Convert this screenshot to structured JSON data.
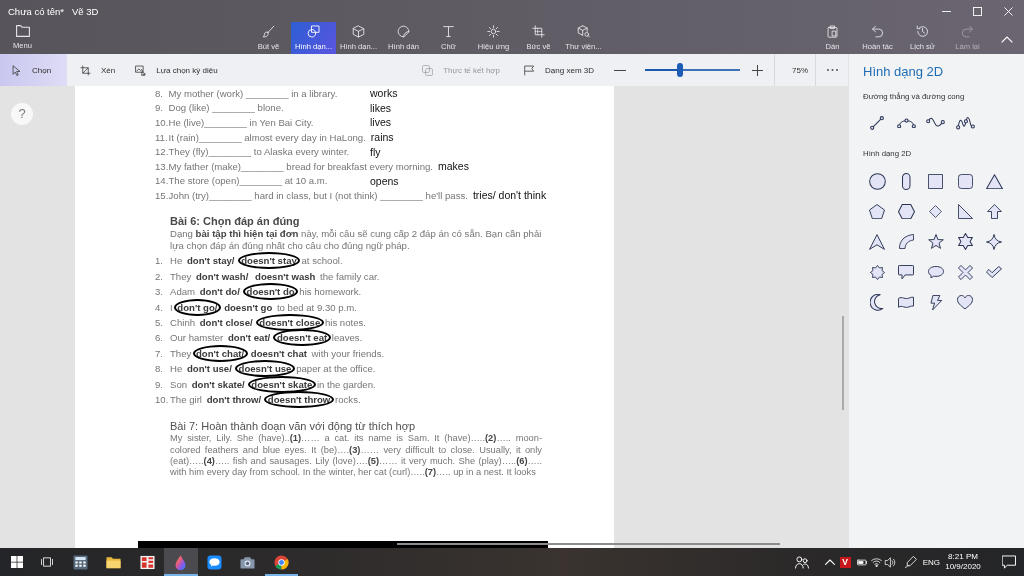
{
  "window": {
    "title": "Chưa có tên*",
    "app_name": "Vẽ 3D"
  },
  "ribbon": {
    "menu": {
      "label": "Menu"
    },
    "tools": [
      {
        "label": "Bút vẽ",
        "selected": false
      },
      {
        "label": "Hình dạn...",
        "selected": true
      },
      {
        "label": "Hình dạn...",
        "selected": false
      },
      {
        "label": "Hình dán",
        "selected": false
      },
      {
        "label": "Chữ",
        "selected": false
      },
      {
        "label": "Hiệu ứng",
        "selected": false
      },
      {
        "label": "Bức vẽ",
        "selected": false
      },
      {
        "label": "Thư viện...",
        "selected": false
      }
    ],
    "actions": [
      {
        "label": "Dán",
        "disabled": false
      },
      {
        "label": "Hoàn tác",
        "disabled": false
      },
      {
        "label": "Lịch sử",
        "disabled": false
      },
      {
        "label": "Làm lại",
        "disabled": true
      }
    ]
  },
  "toolbar": {
    "tools": [
      {
        "label": "Chọn",
        "selected": true
      },
      {
        "label": "Xén",
        "selected": false
      },
      {
        "label": "Lựa chọn kỳ diệu",
        "selected": false
      }
    ],
    "mixed_reality": {
      "label": "Thực tế kết hợp",
      "disabled": true
    },
    "view_3d": {
      "label": "Dạng xem 3D"
    },
    "zoom": {
      "level": 0.37,
      "reading": "75%"
    }
  },
  "canvas": {
    "help_button": {
      "label": "?"
    }
  },
  "document": {
    "exercise_5": {
      "items": [
        {
          "number": "8.",
          "text": "My mother (work) ________ in a library.",
          "answer": "works"
        },
        {
          "number": "9.",
          "text": "Dog (like) ________ blone.",
          "answer": "likes"
        },
        {
          "number": "10.",
          "text": "He (live)________ in Yen Bai City.",
          "answer": "lives"
        },
        {
          "number": "11.",
          "text": "It (rain)________ almost every day in HaLong.",
          "answer": "rains"
        },
        {
          "number": "12.",
          "text": "They (fly)________ to Alaska every winter.",
          "answer": "fly"
        },
        {
          "number": "13.",
          "text": "My father (make)________ bread for breakfast every morning.",
          "answer": "makes"
        },
        {
          "number": "14.",
          "text": "The store (open)________ at 10 a.m.",
          "answer": "opens"
        },
        {
          "number": "15.",
          "text": "John (try)________ hard in class, but I (not think) ________ he'll pass.",
          "answer": "tries/ don't think"
        }
      ]
    },
    "exercise_6": {
      "title": "Bài 6: Chọn đáp án đúng",
      "instructions": "Dạng **bài tập thì hiện tại đơn** này, mỗi câu sẽ cung cấp 2 đáp án có sẵn. Bạn cần phải lựa chọn đáp án đúng nhất cho câu cho đúng ngữ pháp.",
      "items": [
        {
          "number": "1.",
          "subject": "He",
          "choices": [
            {
              "text": "don't stay/",
              "circled": false
            },
            {
              "text": "doesn't stay",
              "circled": true
            }
          ],
          "rest": "at school."
        },
        {
          "number": "2.",
          "subject": "They",
          "choices": [
            {
              "text": "don't wash/",
              "circled": false
            },
            {
              "text": "doesn't wash",
              "circled": false
            }
          ],
          "rest": "the family car."
        },
        {
          "number": "3.",
          "subject": "Adam",
          "choices": [
            {
              "text": "don't do/",
              "circled": false
            },
            {
              "text": "doesn't do",
              "circled": true
            }
          ],
          "rest": "his homework."
        },
        {
          "number": "4.",
          "subject": "I",
          "choices": [
            {
              "text": "don't go/",
              "circled": true
            },
            {
              "text": "doesn't go",
              "circled": false
            }
          ],
          "rest": "to bed at 9.30 p.m."
        },
        {
          "number": "5.",
          "subject": "Chinh",
          "choices": [
            {
              "text": "don't close/",
              "circled": false
            },
            {
              "text": "doesn't close",
              "circled": true
            }
          ],
          "rest": "his notes."
        },
        {
          "number": "6.",
          "subject": "Our hamster",
          "choices": [
            {
              "text": "don't eat/",
              "circled": false
            },
            {
              "text": "doesn't eat",
              "circled": true
            }
          ],
          "rest": "leaves."
        },
        {
          "number": "7.",
          "subject": "They",
          "choices": [
            {
              "text": "don't chat/",
              "circled": true
            },
            {
              "text": "doesn't chat",
              "circled": false
            }
          ],
          "rest": "with your friends."
        },
        {
          "number": "8.",
          "subject": "He",
          "choices": [
            {
              "text": "don't use/",
              "circled": false
            },
            {
              "text": "doesn't use",
              "circled": true
            }
          ],
          "rest": "paper at the office."
        },
        {
          "number": "9.",
          "subject": "Son",
          "choices": [
            {
              "text": "don't skate/",
              "circled": false
            },
            {
              "text": "doesn't skate",
              "circled": true
            }
          ],
          "rest": "in the garden."
        },
        {
          "number": "10.",
          "subject": "The girl",
          "choices": [
            {
              "text": "don't throw/",
              "circled": false
            },
            {
              "text": "doesn't throw",
              "circled": true
            }
          ],
          "rest": "rocks."
        }
      ]
    },
    "exercise_7": {
      "title": "Bài 7: Hoàn thành đoạn văn với động từ thích hợp",
      "text": "My sister, Lily. She (have)..**(1)**…… a cat. its name is Sam. It (have)…..**(2)**….. moon-colored feathers and blue eyes. It (be)….**(3)**…… very difficult to close. Usually, it only (eat)…..**(4)**….. fish and sausages. Lily (love)….**(5)**…… it very much. She (play)…..**(6)**….. with him every day from school. In the winter, her cat (curl)…..**(7)**….. up in a nest. It looks"
    }
  },
  "side_panel": {
    "title": "Hình dạng 2D",
    "sections": [
      {
        "heading": "Đường thẳng và đường cong"
      },
      {
        "heading": "Hình dạng 2D"
      }
    ]
  },
  "taskbar": {
    "apps": [
      {
        "running": false,
        "active": false
      },
      {
        "running": false,
        "active": false
      },
      {
        "running": false,
        "active": false
      },
      {
        "running": true,
        "active": true
      },
      {
        "running": false,
        "active": false
      },
      {
        "running": false,
        "active": false
      },
      {
        "running": true,
        "active": false
      }
    ],
    "tray": {
      "badge": "V",
      "language": "ENG",
      "time": "8:21 PM",
      "date": "10/9/2020"
    }
  }
}
